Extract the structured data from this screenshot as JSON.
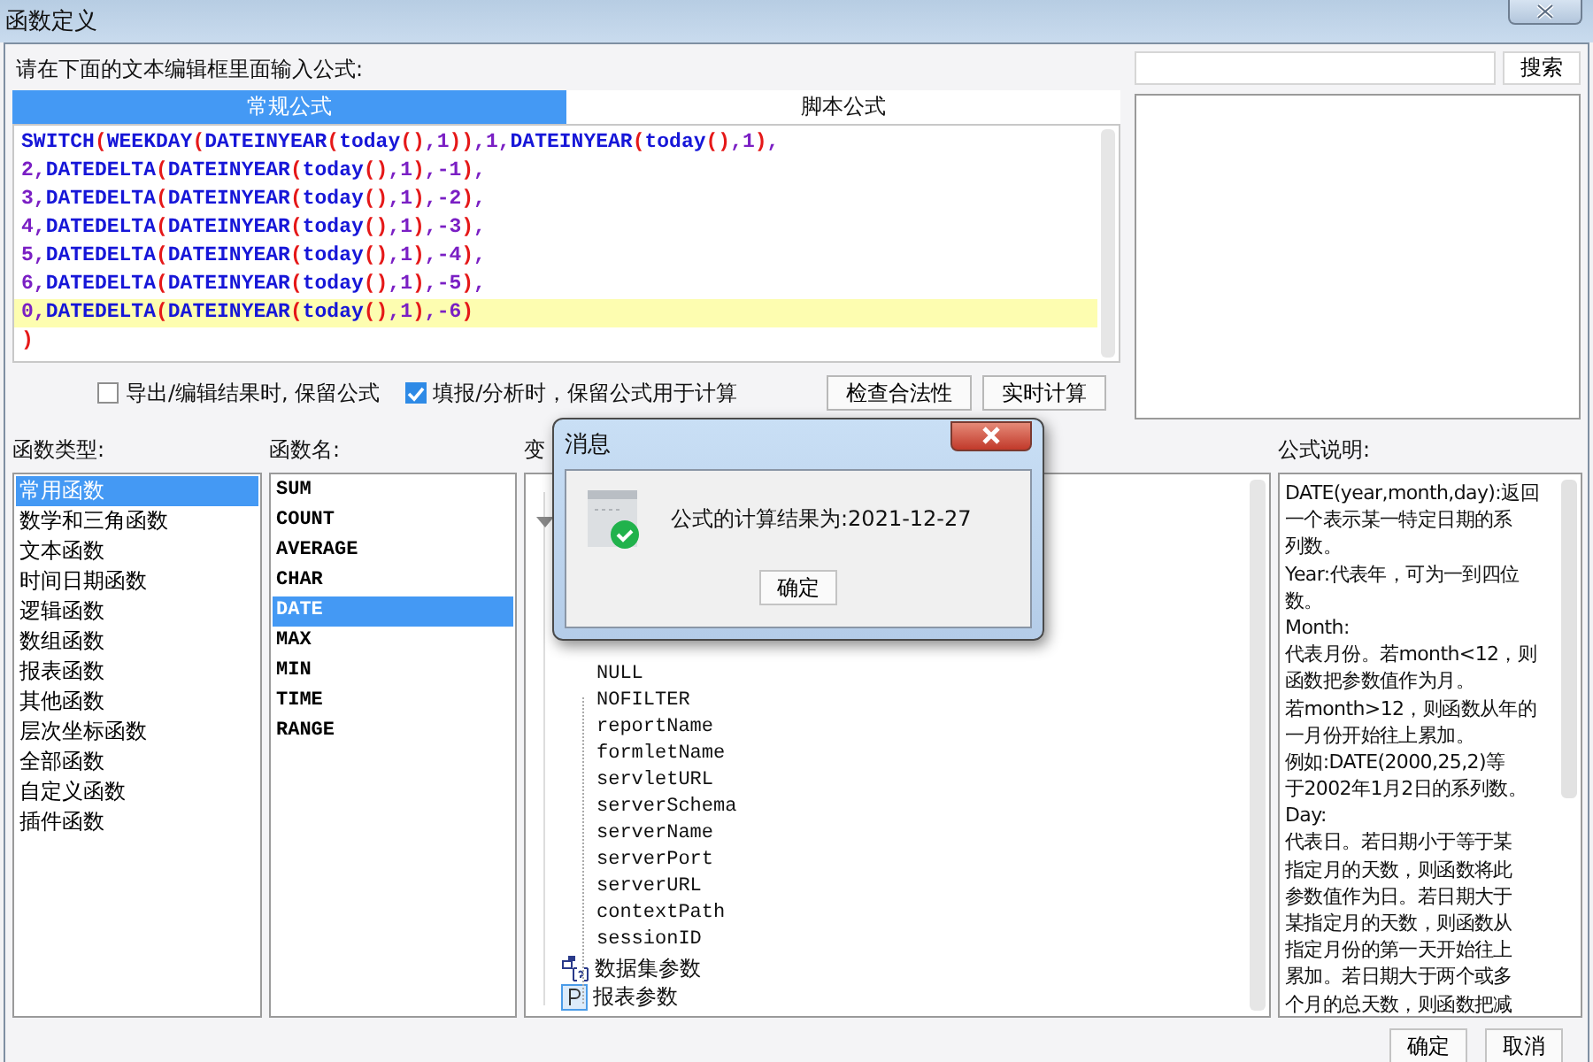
{
  "window": {
    "title": "函数定义"
  },
  "prompt": "请在下面的文本编辑框里面输入公式:",
  "tabs": [
    {
      "label": "常规公式",
      "selected": true
    },
    {
      "label": "脚本公式",
      "selected": false
    }
  ],
  "editor": {
    "lines": [
      {
        "text": "SWITCH(WEEKDAY(DATEINYEAR(today(),1)),1,DATEINYEAR(today(),1),",
        "current": false
      },
      {
        "text": "2,DATEDELTA(DATEINYEAR(today(),1),-1),",
        "current": false
      },
      {
        "text": "3,DATEDELTA(DATEINYEAR(today(),1),-2),",
        "current": false
      },
      {
        "text": "4,DATEDELTA(DATEINYEAR(today(),1),-3),",
        "current": false
      },
      {
        "text": "5,DATEDELTA(DATEINYEAR(today(),1),-4),",
        "current": false
      },
      {
        "text": "6,DATEDELTA(DATEINYEAR(today(),1),-5),",
        "current": false
      },
      {
        "text": "0,DATEDELTA(DATEINYEAR(today(),1),-6)",
        "current": true
      },
      {
        "text": ")",
        "current": false
      }
    ]
  },
  "options": [
    {
      "label": "导出/编辑结果时, 保留公式",
      "checked": false
    },
    {
      "label": "填报/分析时，保留公式用于计算",
      "checked": true
    }
  ],
  "actions": [
    "检查合法性",
    "实时计算"
  ],
  "search": {
    "button": "搜索"
  },
  "function_types": {
    "label": "函数类型:",
    "items": [
      {
        "label": "常用函数",
        "selected": true
      },
      {
        "label": "数学和三角函数",
        "selected": false
      },
      {
        "label": "文本函数",
        "selected": false
      },
      {
        "label": "时间日期函数",
        "selected": false
      },
      {
        "label": "逻辑函数",
        "selected": false
      },
      {
        "label": "数组函数",
        "selected": false
      },
      {
        "label": "报表函数",
        "selected": false
      },
      {
        "label": "其他函数",
        "selected": false
      },
      {
        "label": "层次坐标函数",
        "selected": false
      },
      {
        "label": "全部函数",
        "selected": false
      },
      {
        "label": "自定义函数",
        "selected": false
      },
      {
        "label": "插件函数",
        "selected": false
      }
    ]
  },
  "function_names": {
    "label": "函数名:",
    "items": [
      {
        "label": "SUM",
        "selected": false
      },
      {
        "label": "COUNT",
        "selected": false
      },
      {
        "label": "AVERAGE",
        "selected": false
      },
      {
        "label": "CHAR",
        "selected": false
      },
      {
        "label": "DATE",
        "selected": true
      },
      {
        "label": "MAX",
        "selected": false
      },
      {
        "label": "MIN",
        "selected": false
      },
      {
        "label": "TIME",
        "selected": false
      },
      {
        "label": "RANGE",
        "selected": false
      }
    ]
  },
  "variables": {
    "label": "变",
    "items": [
      "NULL",
      "NOFILTER",
      "reportName",
      "formletName",
      "servletURL",
      "serverSchema",
      "serverName",
      "serverPort",
      "serverURL",
      "contextPath",
      "sessionID"
    ],
    "groups": [
      {
        "label": "数据集参数",
        "kind": "dataset"
      },
      {
        "label": "报表参数",
        "kind": "param"
      }
    ]
  },
  "description": {
    "label": "公式说明:",
    "lines": [
      "DATE(year,month,day):返回",
      "一个表示某一特定日期的系",
      "列数。",
      "Year:代表年，可为一到四位",
      "数。",
      "Month:",
      "代表月份。若month<12，则",
      "函数把参数值作为月。",
      "若month>12，则函数从年的",
      "一月份开始往上累加。",
      "例如:DATE(2000,25,2)等",
      "于2002年1月2日的系列数。",
      "Day:",
      "代表日。若日期小于等于某",
      "指定月的天数，则函数将此",
      "参数值作为日。若日期大于",
      "某指定月的天数，则函数从",
      "指定月份的第一天开始往上",
      "累加。若日期大于两个或多",
      "个月的总天数，则函数把减"
    ]
  },
  "buttons": [
    "确定",
    "取消"
  ],
  "message": {
    "title": "消息",
    "text": "公式的计算结果为:2021-12-27",
    "button": "确定"
  }
}
